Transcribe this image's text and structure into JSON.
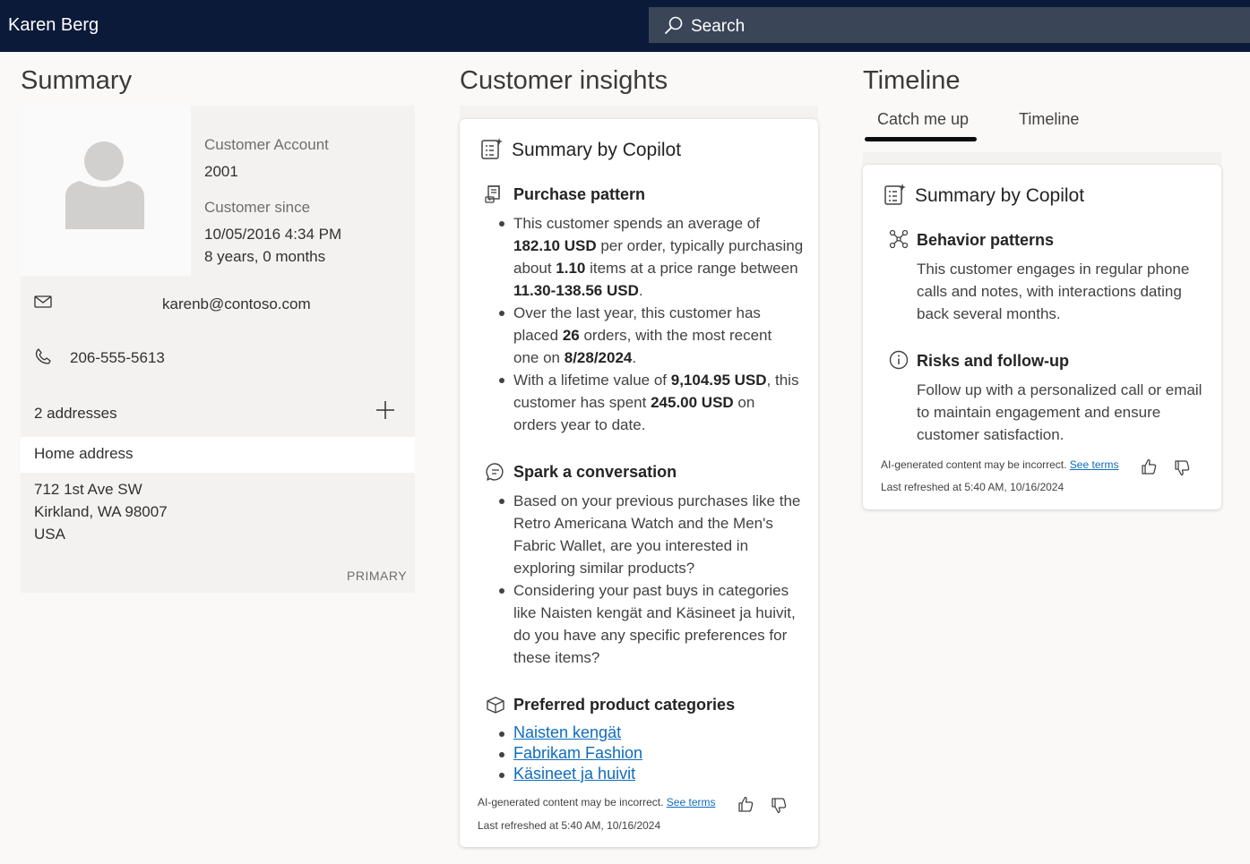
{
  "topbar": {
    "user_name": "Karen Berg",
    "search_placeholder": "Search"
  },
  "summary": {
    "heading": "Summary",
    "account_label": "Customer Account",
    "account_value": "2001",
    "since_label": "Customer since",
    "since_date": "10/05/2016 4:34 PM",
    "since_duration": "8 years, 0 months",
    "email": "karenb@contoso.com",
    "phone": "206-555-5613",
    "addresses_count": "2 addresses",
    "home_address_label": "Home address",
    "address_line1": "712 1st Ave SW",
    "address_line2": "Kirkland, WA 98007",
    "address_line3": "USA",
    "primary_badge": "PRIMARY"
  },
  "insights": {
    "heading": "Customer insights",
    "card_title": "Summary by Copilot",
    "purchase": {
      "title": "Purchase pattern",
      "b1": {
        "t1": "This customer spends an average of",
        "v1": "182.10 USD",
        "t2": " per order, typically purchasing",
        "t3": "about ",
        "v2": "1.10",
        "t4": " items at a price range between",
        "v3": "11.30-138.56 USD",
        "t5": "."
      },
      "b2": {
        "t1": "Over the last year, this customer has",
        "t2": "placed ",
        "v1": "26",
        "t3": " orders, with the most recent",
        "t4": "one on ",
        "v2": "8/28/2024",
        "t5": "."
      },
      "b3": {
        "t1": "With a lifetime value of ",
        "v1": "9,104.95 USD",
        "t2": ", this",
        "t3": "customer has spent ",
        "v2": "245.00 USD",
        "t4": " on",
        "t5": "orders year to date."
      }
    },
    "spark": {
      "title": "Spark a conversation",
      "b1": [
        "Based on your previous purchases like the",
        "Retro Americana Watch and the Men's",
        "Fabric Wallet, are you interested in",
        "exploring similar products?"
      ],
      "b2": [
        "Considering your past buys in categories",
        "like Naisten kengät and Käsineet ja huivit,",
        "do you have any specific preferences for",
        "these items?"
      ]
    },
    "categories": {
      "title": "Preferred product categories",
      "items": [
        "Naisten kengät",
        "Fabrikam Fashion",
        "Käsineet ja huivit"
      ]
    },
    "disclaimer": "AI-generated content may be incorrect.",
    "see_terms": "See terms",
    "refreshed": "Last refreshed at 5:40 AM, 10/16/2024"
  },
  "timeline": {
    "heading": "Timeline",
    "tabs": [
      "Catch me up",
      "Timeline"
    ],
    "card_title": "Summary by Copilot",
    "behavior": {
      "title": "Behavior patterns",
      "lines": [
        "This customer engages in regular phone",
        "calls and notes, with interactions dating",
        "back several months."
      ]
    },
    "risks": {
      "title": "Risks and follow-up",
      "lines": [
        "Follow up with a personalized call or email",
        "to maintain engagement and ensure",
        "customer satisfaction."
      ]
    },
    "disclaimer": "AI-generated content may be incorrect.",
    "see_terms": "See terms",
    "refreshed": "Last refreshed at 5:40 AM, 10/16/2024"
  },
  "colors": {
    "topbar": "#0c1a3a",
    "search": "#3a4658",
    "link": "#0f6cbd",
    "tab_indicator": "#0c0c0c"
  }
}
